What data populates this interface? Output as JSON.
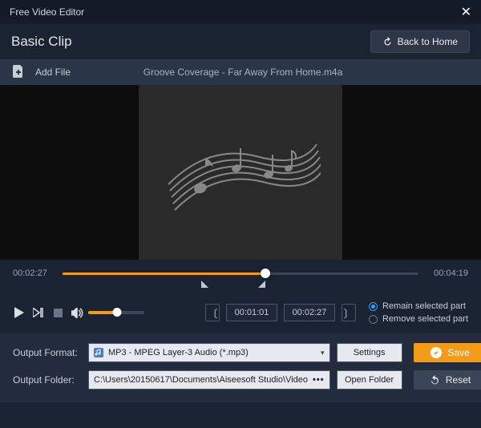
{
  "titlebar": {
    "title": "Free Video Editor"
  },
  "header": {
    "page_title": "Basic Clip",
    "back_label": "Back to Home"
  },
  "filebar": {
    "add_label": "Add File",
    "current_file": "Groove Coverage - Far Away From Home.m4a"
  },
  "timeline": {
    "start_time": "00:02:27",
    "end_time": "00:04:19",
    "progress_pct": 57,
    "marker_start_pct": 39,
    "marker_end_pct": 57
  },
  "clip": {
    "in_time": "00:01:01",
    "out_time": "00:02:27"
  },
  "volume": {
    "level_pct": 52
  },
  "options": {
    "remain_label": "Remain selected part",
    "remove_label": "Remove selected part",
    "selected": "remain"
  },
  "output": {
    "format_label": "Output Format:",
    "format_value": "MP3 - MPEG Layer-3 Audio (*.mp3)",
    "folder_label": "Output Folder:",
    "folder_value": "C:\\Users\\20150617\\Documents\\Aiseesoft Studio\\Video",
    "settings_btn": "Settings",
    "open_folder_btn": "Open Folder"
  },
  "actions": {
    "save": "Save",
    "reset": "Reset"
  }
}
